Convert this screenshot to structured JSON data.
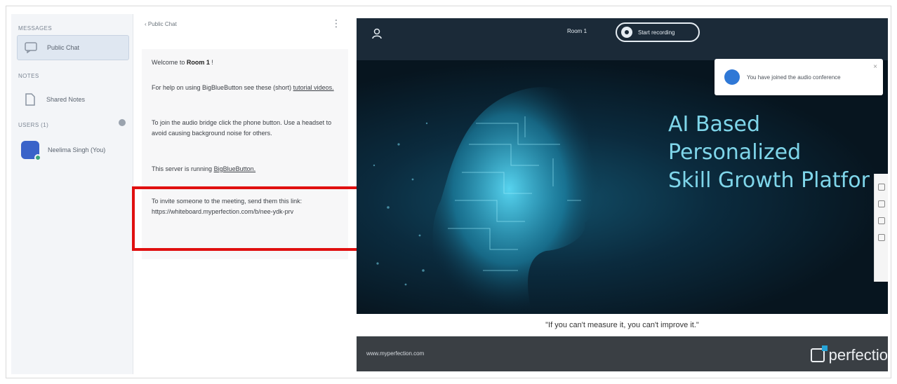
{
  "sidebar": {
    "messages_section": "MESSAGES",
    "public_chat_label": "Public Chat",
    "notes_section": "NOTES",
    "shared_notes_label": "Shared Notes",
    "users_section": "USERS (1)",
    "user_name": "Neelima Singh (You)"
  },
  "chat": {
    "header": "‹ Public Chat",
    "welcome_prefix": "Welcome to ",
    "room_name": "Room 1",
    "welcome_suffix": " !",
    "help_text": "For help on using BigBlueButton see these (short)",
    "help_link": "tutorial videos.",
    "audio_text": "To join the audio bridge click the phone button. Use a headset to avoid causing background noise for others.",
    "server_text": "This server is running",
    "server_link": "BigBlueButton.",
    "invite_text": "To invite someone to the meeting, send them this link:",
    "invite_link": "https://whiteboard.myperfection.com/b/nee-ydk-prv"
  },
  "presentation": {
    "room_title": "Room 1",
    "record_label": "Start recording",
    "toast_text": "You have joined the audio conference",
    "slide_title_line1": "AI Based",
    "slide_title_line2": "Personalized",
    "slide_title_line3": "Skill Growth Platfor",
    "quote": "\"If you can't measure it, you can't improve it.\"",
    "footer_url": "www.myperfection.com",
    "footer_brand": "perfectio"
  },
  "colors": {
    "highlight": "#e01010",
    "slide_accent": "#7fd6ea",
    "topbar": "#1b2a38"
  }
}
